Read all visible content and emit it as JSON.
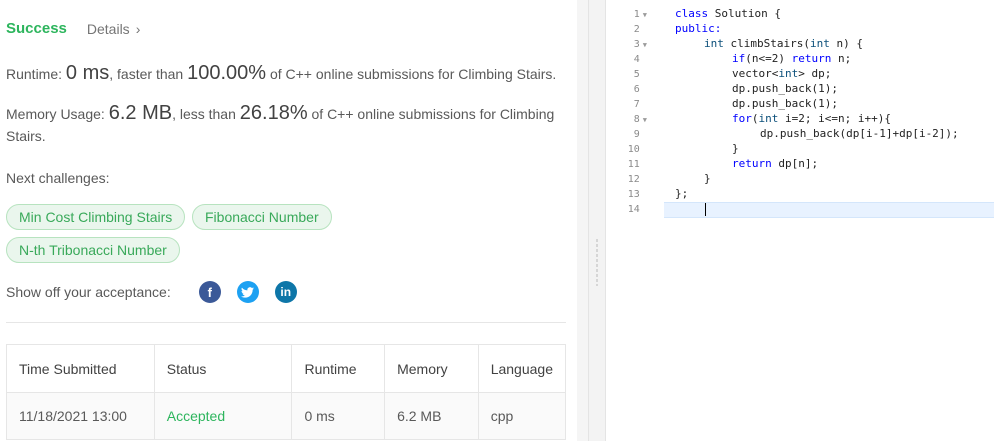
{
  "result": {
    "status": "Success",
    "details_label": "Details",
    "details_chevron": "›",
    "runtime_prefix": "Runtime: ",
    "runtime_value": "0 ms",
    "runtime_mid": ", faster than ",
    "runtime_pct": "100.00%",
    "runtime_suffix": " of C++ online submissions for Climbing Stairs.",
    "memory_prefix": "Memory Usage: ",
    "memory_value": "6.2 MB",
    "memory_mid": ", less than ",
    "memory_pct": "26.18%",
    "memory_suffix": " of C++ online submissions for Climbing Stairs."
  },
  "next_challenges": {
    "label": "Next challenges:",
    "items": [
      "Min Cost Climbing Stairs",
      "Fibonacci Number",
      "N-th Tribonacci Number"
    ]
  },
  "share": {
    "label": "Show off your acceptance:",
    "icons": [
      "facebook-icon",
      "twitter-icon",
      "linkedin-icon"
    ],
    "fb_glyph": "f",
    "tw_glyph": "🐦",
    "li_glyph": "in"
  },
  "table": {
    "headers": [
      "Time Submitted",
      "Status",
      "Runtime",
      "Memory",
      "Language"
    ],
    "rows": [
      {
        "time": "11/18/2021 13:00",
        "status": "Accepted",
        "runtime": "0 ms",
        "memory": "6.2 MB",
        "language": "cpp"
      }
    ]
  },
  "editor": {
    "line_numbers": [
      "1",
      "2",
      "3",
      "4",
      "5",
      "6",
      "7",
      "8",
      "9",
      "10",
      "11",
      "12",
      "13",
      "14"
    ],
    "fold_marker": "▼",
    "code": {
      "l1a": "class",
      "l1b": " Solution {",
      "l2": "public:",
      "l3a": "int",
      "l3b": " climbStairs(",
      "l3c": "int",
      "l3d": " n) {",
      "l4a": "if",
      "l4b": "(n<=2) ",
      "l4c": "return",
      "l4d": " n;",
      "l5a": "vector<",
      "l5b": "int",
      "l5c": "> dp;",
      "l6": "dp.push_back(1);",
      "l7": "dp.push_back(1);",
      "l8a": "for",
      "l8b": "(",
      "l8c": "int",
      "l8d": " i=2; i<=n; i++){",
      "l9": "dp.push_back(dp[i-1]+dp[i-2]);",
      "l10": "}",
      "l11a": "return",
      "l11b": " dp[n];",
      "l12": "}",
      "l13": "};"
    }
  }
}
